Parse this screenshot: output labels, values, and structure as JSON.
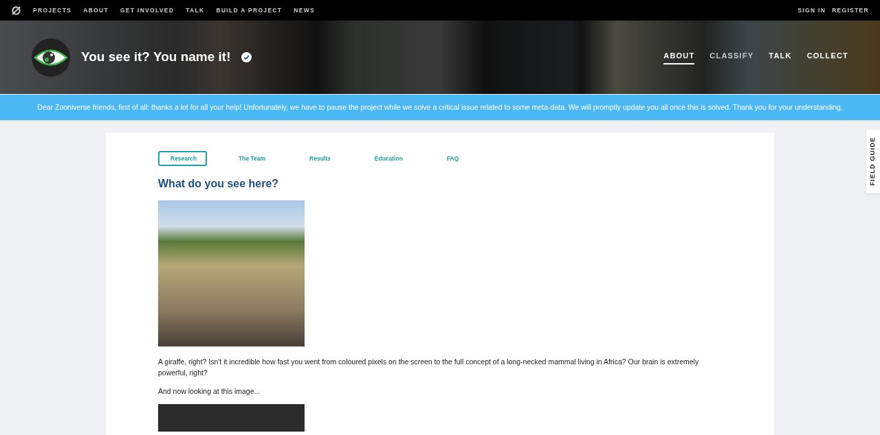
{
  "top_nav": {
    "links": [
      "PROJECTS",
      "ABOUT",
      "GET INVOLVED",
      "TALK",
      "BUILD A PROJECT",
      "NEWS"
    ],
    "account_links": [
      "SIGN IN",
      "REGISTER"
    ]
  },
  "project_header": {
    "title": "You see it? You name it!",
    "verified": true,
    "nav": [
      {
        "label": "ABOUT",
        "selected": true,
        "disabled": false
      },
      {
        "label": "CLASSIFY",
        "selected": false,
        "disabled": true
      },
      {
        "label": "TALK",
        "selected": false,
        "disabled": false
      },
      {
        "label": "COLLECT",
        "selected": false,
        "disabled": false
      }
    ]
  },
  "announcement": "Dear Zooniverse friends, first of all: thanks a lot for all your help! Unfortunately, we have to pause the project while we solve a critical issue related to some meta-data. We will promptly update you all once this is solved. Thank you for your understanding.",
  "about_tabs": [
    {
      "label": "Research",
      "selected": true
    },
    {
      "label": "The Team",
      "selected": false
    },
    {
      "label": "Results",
      "selected": false
    },
    {
      "label": "Education",
      "selected": false
    },
    {
      "label": "FAQ",
      "selected": false
    }
  ],
  "content": [
    {
      "kind": "heading",
      "text": "What do you see here?"
    },
    {
      "kind": "photo"
    },
    {
      "kind": "paragraph",
      "text": "A giraffe, right? Isn't it incredible how fast you went from coloured pixels on the screen to the full concept of a long-necked mammal living in Africa? Our brain is extremely powerful, right?"
    },
    {
      "kind": "paragraph",
      "text": "And now looking at this image..."
    },
    {
      "kind": "dark_image"
    }
  ],
  "field_guide": "FIELD GUIDE"
}
